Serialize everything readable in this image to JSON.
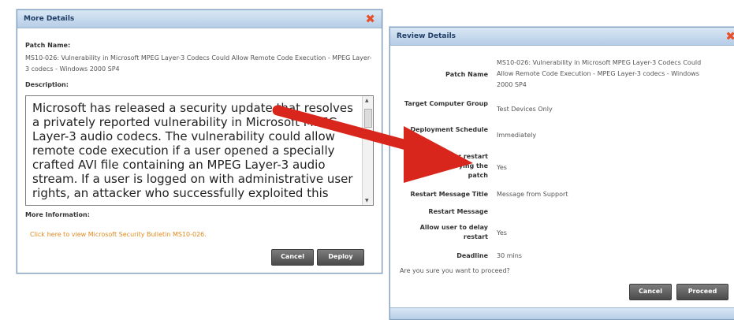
{
  "more_details": {
    "title": "More Details",
    "patch_name_label": "Patch Name:",
    "patch_name_value": "MS10-026: Vulnerability in Microsoft MPEG Layer-3 Codecs Could Allow Remote Code Execution - MPEG Layer-3 codecs - Windows 2000 SP4",
    "description_label": "Description:",
    "description_text": "Microsoft has released a security update that resolves a privately reported vulnerability in Microsoft MPEG Layer-3 audio codecs. The vulnerability could allow remote code execution if a user opened a specially crafted AVI file containing an MPEG Layer-3 audio stream. If a user is logged on with administrative user rights, an attacker who successfully exploited this",
    "more_info_label": "More Information:",
    "bulletin_link": "Click here to view Microsoft Security Bulletin MS10-026.",
    "cancel_label": "Cancel",
    "deploy_label": "Deploy"
  },
  "review_details": {
    "title": "Review Details",
    "rows": [
      {
        "label": "Patch Name",
        "value": "MS10-026: Vulnerability in Microsoft MPEG Layer-3 Codecs Could Allow Remote Code Execution - MPEG Layer-3 codecs - Windows 2000 SP4"
      },
      {
        "label": "Target Computer Group",
        "value": "Test Devices Only"
      },
      {
        "label": "Deployment Schedule",
        "value": "Immediately"
      },
      {
        "label": "for restart\nying the\npatch",
        "value": "Yes"
      },
      {
        "label": "Restart Message Title",
        "value": "Message from Support"
      },
      {
        "label": "Restart Message",
        "value": ""
      },
      {
        "label": "Allow user to delay restart",
        "value": "Yes"
      },
      {
        "label": "Deadline",
        "value": "30 mins"
      }
    ],
    "confirm_text": "Are you sure you want to proceed?",
    "cancel_label": "Cancel",
    "proceed_label": "Proceed"
  },
  "colors": {
    "close": "#e8502c",
    "arrow": "#d9261c",
    "link": "#e08a1e"
  }
}
